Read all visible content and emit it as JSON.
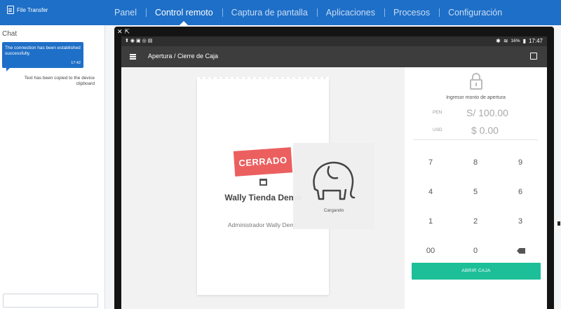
{
  "app": {
    "brand": "File Transfer"
  },
  "nav": {
    "tabs": [
      {
        "label": "Panel"
      },
      {
        "label": "Control remoto",
        "active": true
      },
      {
        "label": "Captura de pantalla"
      },
      {
        "label": "Aplicaciones"
      },
      {
        "label": "Procesos"
      },
      {
        "label": "Configuración"
      }
    ]
  },
  "chat": {
    "title": "Chat",
    "message": "The connection has been established successfully.",
    "message_time": "17:42",
    "note": "Text has been copied to the device clipboard"
  },
  "device": {
    "tools": [
      "✕",
      "⇱"
    ],
    "status": {
      "battery_pct": "16%",
      "time": "17:47"
    },
    "app_title": "Apertura / Cierre de Caja",
    "store": {
      "badge": "CERRADO",
      "name": "Wally Tienda Demo",
      "admin": "Administrador Wally Demo"
    },
    "loader_text": "Cargando",
    "open_label": "Ingresor monto de apertura",
    "currencies": [
      {
        "code": "PEN",
        "amount": "S/ 100.00"
      },
      {
        "code": "USD",
        "amount": "$ 0.00"
      }
    ],
    "keypad": [
      "7",
      "8",
      "9",
      "4",
      "5",
      "6",
      "1",
      "2",
      "3",
      "00",
      "0"
    ],
    "open_button": "ABRIR CAJA"
  },
  "colors": {
    "nav_bg": "#1e6fc7",
    "badge": "#ec5f5f",
    "button": "#1dbf98"
  }
}
